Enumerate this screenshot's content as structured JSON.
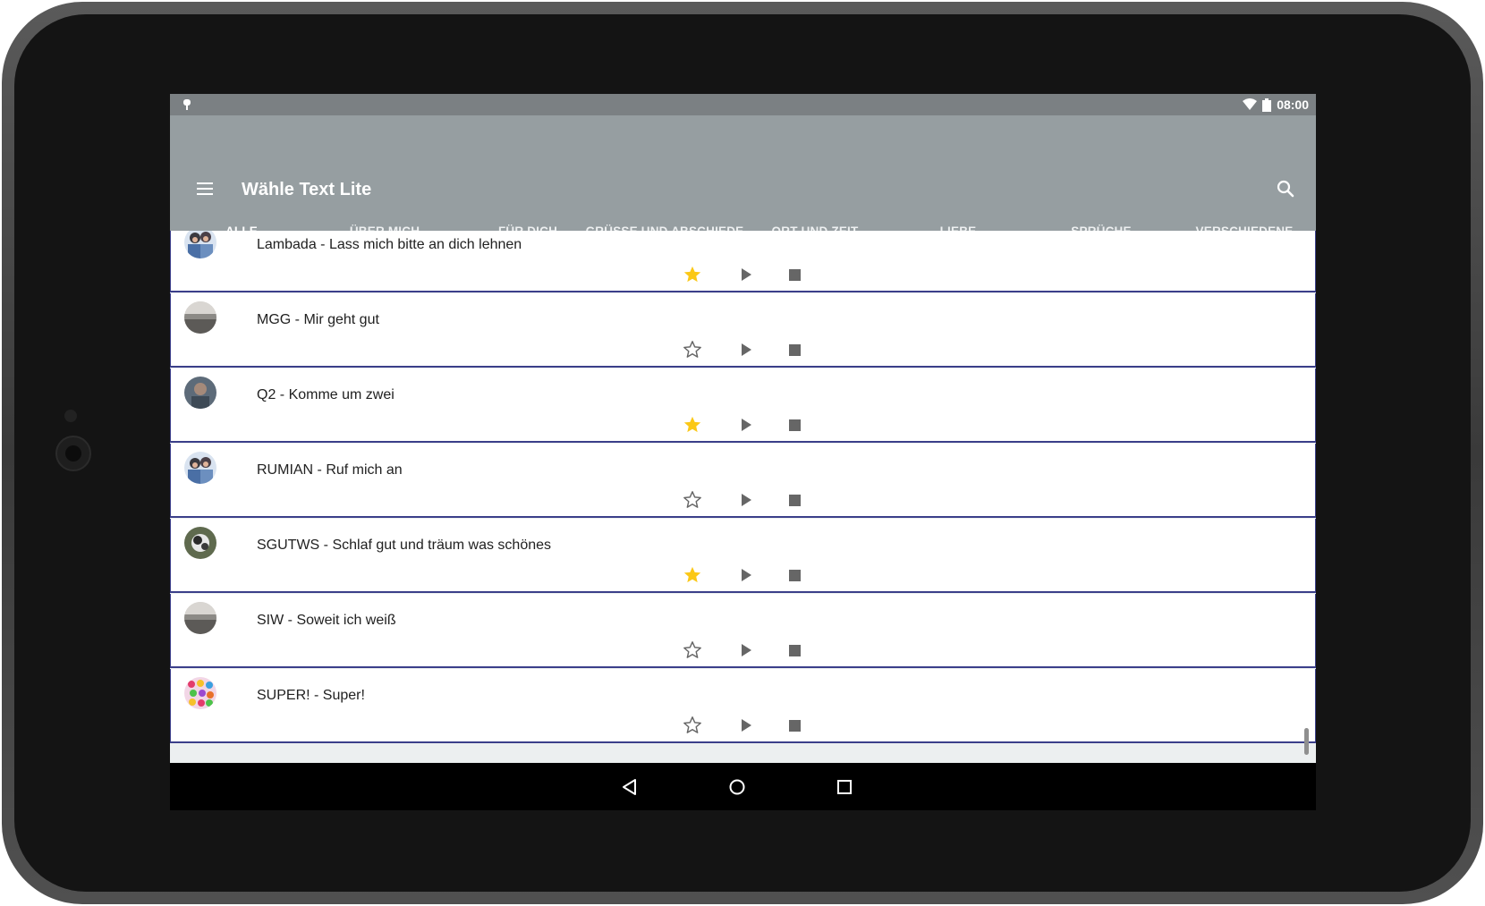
{
  "statusbar": {
    "time": "08:00",
    "icons": [
      "android-debug-icon",
      "wifi-icon",
      "battery-icon"
    ]
  },
  "appbar": {
    "title": "Wähle Text Lite",
    "menu_icon": "hamburger-menu-icon",
    "search_icon": "search-icon"
  },
  "colors": {
    "appbar": "#969ea1",
    "statusbar": "#7b8083",
    "tab_indicator": "#33b745",
    "star_filled": "#fbc817",
    "item_border": "#3b3f8a"
  },
  "tabs": [
    {
      "label": "ALLE",
      "active": true
    },
    {
      "label": "ÜBER MICH"
    },
    {
      "label": "FÜR DICH"
    },
    {
      "label": "GRÜSSE UND ABSCHIEDE"
    },
    {
      "label": "ORT UND ZEIT"
    },
    {
      "label": "LIEBE"
    },
    {
      "label": "SPRÜCHE"
    },
    {
      "label": "VERSCHIEDENE"
    }
  ],
  "items": [
    {
      "title": "Lambada - Lass mich bitte an dich lehnen",
      "favorite": true,
      "avatar": "couple-photo"
    },
    {
      "title": "MGG - Mir geht gut",
      "favorite": false,
      "avatar": "landscape-photo"
    },
    {
      "title": "Q2 - Komme um zwei",
      "favorite": true,
      "avatar": "portrait-photo"
    },
    {
      "title": "RUMIAN - Ruf mich an",
      "favorite": false,
      "avatar": "couple-photo"
    },
    {
      "title": "SGUTWS - Schlaf gut und träum was schönes",
      "favorite": true,
      "avatar": "cat-photo"
    },
    {
      "title": "SIW - Soweit ich weiß",
      "favorite": false,
      "avatar": "landscape-photo"
    },
    {
      "title": "SUPER! - Super!",
      "favorite": false,
      "avatar": "candy-photo"
    }
  ],
  "navbar": {
    "back_icon": "back-triangle-icon",
    "home_icon": "home-circle-icon",
    "recents_icon": "recents-square-icon"
  }
}
